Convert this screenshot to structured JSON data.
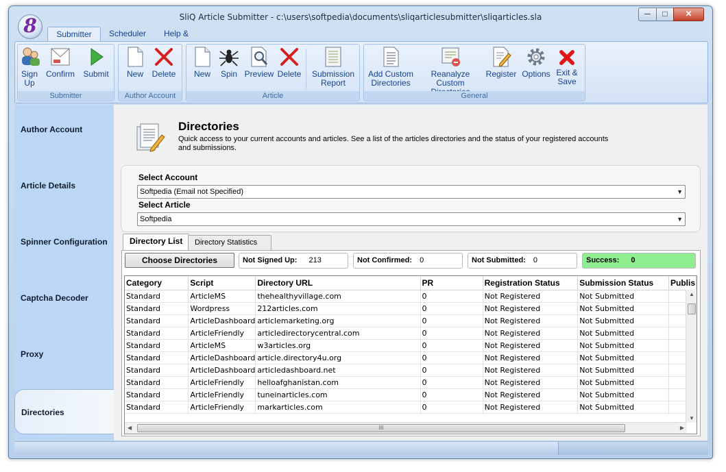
{
  "window": {
    "title": "SliQ Article Submitter - c:\\users\\softpedia\\documents\\sliqarticlesubmitter\\sliqarticles.sla",
    "min_label": "─",
    "max_label": "□",
    "close_label": "✕",
    "app_logo_letter": "8"
  },
  "ribbon_tabs": [
    {
      "label": "Submitter"
    },
    {
      "label": "Scheduler"
    },
    {
      "label": "Help & Support"
    }
  ],
  "ribbon_groups": {
    "submitter": {
      "label": "Submitter",
      "buttons": [
        {
          "label": "Sign\nUp",
          "icon": "users-icon"
        },
        {
          "label": "Confirm",
          "icon": "envelope-icon"
        },
        {
          "label": "Submit",
          "icon": "play-icon"
        }
      ]
    },
    "author_account": {
      "label": "Author Account",
      "buttons": [
        {
          "label": "New",
          "icon": "new-document-icon"
        },
        {
          "label": "Delete",
          "icon": "delete-x-icon"
        }
      ]
    },
    "article": {
      "label": "Article",
      "buttons": [
        {
          "label": "New",
          "icon": "new-document-icon"
        },
        {
          "label": "Spin",
          "icon": "spider-icon"
        },
        {
          "label": "Preview",
          "icon": "magnifier-document-icon"
        },
        {
          "label": "Delete",
          "icon": "delete-x-icon"
        },
        {
          "label": "Submission\nReport",
          "icon": "report-icon"
        }
      ]
    },
    "general": {
      "label": "General",
      "buttons": [
        {
          "label": "Add Custom\nDirectories",
          "icon": "list-document-icon"
        },
        {
          "label": "Reanalyze Custom\nDirectories",
          "icon": "reanalyze-icon"
        },
        {
          "label": "Register",
          "icon": "pencil-document-icon"
        },
        {
          "label": "Options",
          "icon": "gear-icon"
        },
        {
          "label": "Exit &\nSave",
          "icon": "exit-x-icon"
        }
      ]
    }
  },
  "sidebar": {
    "items": [
      {
        "label": "Author Account"
      },
      {
        "label": "Article Details"
      },
      {
        "label": "Spinner Configuration"
      },
      {
        "label": "Captcha Decoder"
      },
      {
        "label": "Proxy"
      },
      {
        "label": "Directories",
        "active": true
      }
    ]
  },
  "page": {
    "title": "Directories",
    "description": "Quick access to your current accounts and articles. See a list of the articles directories and the status of your registered accounts and submissions."
  },
  "selectors": {
    "account_label": "Select Account",
    "account_value": "Softpedia (Email not Specified)",
    "article_label": "Select Article",
    "article_value": "Softpedia"
  },
  "dir_tabs": [
    {
      "label": "Directory List",
      "active": true
    },
    {
      "label": "Directory Statistics"
    }
  ],
  "toolbar": {
    "choose_label": "Choose Directories"
  },
  "stats": {
    "not_signed_up_label": "Not Signed Up:",
    "not_signed_up_value": "213",
    "not_confirmed_label": "Not Confirmed:",
    "not_confirmed_value": "0",
    "not_submitted_label": "Not Submitted:",
    "not_submitted_value": "0",
    "success_label": "Success:",
    "success_value": "0",
    "success_color": "#90ee90"
  },
  "table": {
    "columns": [
      "Category",
      "Script",
      "Directory URL",
      "PR",
      "Registration Status",
      "Submission Status",
      "Publis"
    ],
    "rows": [
      [
        "Standard",
        "ArticleMS",
        "thehealthyvillage.com",
        "0",
        "Not Registered",
        "Not Submitted"
      ],
      [
        "Standard",
        "Wordpress",
        "212articles.com",
        "0",
        "Not Registered",
        "Not Submitted"
      ],
      [
        "Standard",
        "ArticleDashboard",
        "articlemarketing.org",
        "0",
        "Not Registered",
        "Not Submitted"
      ],
      [
        "Standard",
        "ArticleFriendly",
        "articledirectorycentral.com",
        "0",
        "Not Registered",
        "Not Submitted"
      ],
      [
        "Standard",
        "ArticleMS",
        "w3articles.org",
        "0",
        "Not Registered",
        "Not Submitted"
      ],
      [
        "Standard",
        "ArticleDashboard",
        "article.directory4u.org",
        "0",
        "Not Registered",
        "Not Submitted"
      ],
      [
        "Standard",
        "ArticleDashboard",
        "articledashboard.net",
        "0",
        "Not Registered",
        "Not Submitted"
      ],
      [
        "Standard",
        "ArticleFriendly",
        "helloafghanistan.com",
        "0",
        "Not Registered",
        "Not Submitted"
      ],
      [
        "Standard",
        "ArticleFriendly",
        "tuneinarticles.com",
        "0",
        "Not Registered",
        "Not Submitted"
      ],
      [
        "Standard",
        "ArticleFriendly",
        "markarticles.com",
        "0",
        "Not Registered",
        "Not Submitted"
      ]
    ]
  },
  "scroll": {
    "thumb_grip": "III",
    "up_arrow": "▲",
    "down_arrow": "▼",
    "left_arrow": "◀",
    "right_arrow": "▶"
  }
}
